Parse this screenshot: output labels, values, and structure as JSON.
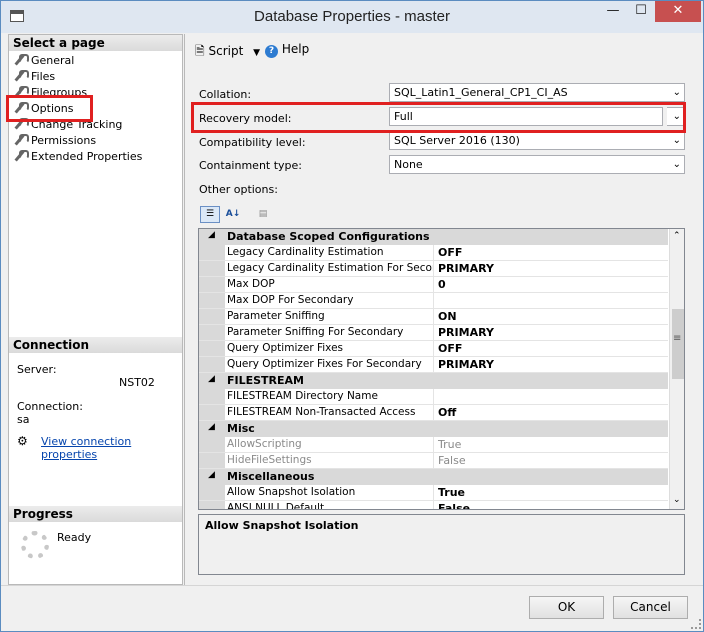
{
  "window": {
    "title": "Database Properties - master"
  },
  "sidebar": {
    "select_page_header": "Select a page",
    "items": [
      {
        "label": "General"
      },
      {
        "label": "Files"
      },
      {
        "label": "Filegroups"
      },
      {
        "label": "Options"
      },
      {
        "label": "Change Tracking"
      },
      {
        "label": "Permissions"
      },
      {
        "label": "Extended Properties"
      }
    ],
    "connection_header": "Connection",
    "server_label": "Server:",
    "server_value": "NST02",
    "connection_label": "Connection:",
    "connection_value": "sa",
    "view_connection_link": "View connection properties",
    "progress_header": "Progress",
    "progress_status": "Ready"
  },
  "toolbar": {
    "script_label": "Script",
    "help_label": "Help"
  },
  "form": {
    "collation_label": "Collation:",
    "collation_value": "SQL_Latin1_General_CP1_CI_AS",
    "recovery_label": "Recovery model:",
    "recovery_value": "Full",
    "compat_label": "Compatibility level:",
    "compat_value": "SQL Server 2016 (130)",
    "containment_label": "Containment type:",
    "containment_value": "None",
    "other_options_label": "Other options:"
  },
  "grid": {
    "rows": [
      {
        "type": "cat",
        "name": "Database Scoped Configurations"
      },
      {
        "type": "prop",
        "name": "Legacy Cardinality Estimation",
        "value": "OFF"
      },
      {
        "type": "prop",
        "name": "Legacy Cardinality Estimation For Secondary",
        "value": "PRIMARY"
      },
      {
        "type": "prop",
        "name": "Max DOP",
        "value": "0"
      },
      {
        "type": "prop",
        "name": "Max DOP For Secondary",
        "value": ""
      },
      {
        "type": "prop",
        "name": "Parameter Sniffing",
        "value": "ON"
      },
      {
        "type": "prop",
        "name": "Parameter Sniffing For Secondary",
        "value": "PRIMARY"
      },
      {
        "type": "prop",
        "name": "Query Optimizer Fixes",
        "value": "OFF"
      },
      {
        "type": "prop",
        "name": "Query Optimizer Fixes For Secondary",
        "value": "PRIMARY"
      },
      {
        "type": "cat",
        "name": "FILESTREAM"
      },
      {
        "type": "prop",
        "name": "FILESTREAM Directory Name",
        "value": ""
      },
      {
        "type": "prop",
        "name": "FILESTREAM Non-Transacted Access",
        "value": "Off"
      },
      {
        "type": "cat",
        "name": "Misc"
      },
      {
        "type": "dim",
        "name": "AllowScripting",
        "value": "True"
      },
      {
        "type": "dim",
        "name": "HideFileSettings",
        "value": "False"
      },
      {
        "type": "cat",
        "name": "Miscellaneous"
      },
      {
        "type": "prop",
        "name": "Allow Snapshot Isolation",
        "value": "True"
      },
      {
        "type": "prop",
        "name": "ANSI NULL Default",
        "value": "False"
      }
    ]
  },
  "description": {
    "text": "Allow Snapshot Isolation"
  },
  "footer": {
    "ok_label": "OK",
    "cancel_label": "Cancel"
  },
  "icons": {
    "app": "database-icon",
    "wrench": "wrench-icon",
    "script": "script-icon",
    "help": "help-icon",
    "categorized": "categorized-icon",
    "alphabetical": "sort-alpha-icon",
    "property_pages": "property-pages-icon",
    "connection": "connection-icon",
    "progress": "spinner-icon"
  },
  "colors": {
    "highlight_box": "#e02020",
    "link": "#0645ad",
    "titlebar": "#dfe7f1",
    "close_button": "#c75050"
  }
}
